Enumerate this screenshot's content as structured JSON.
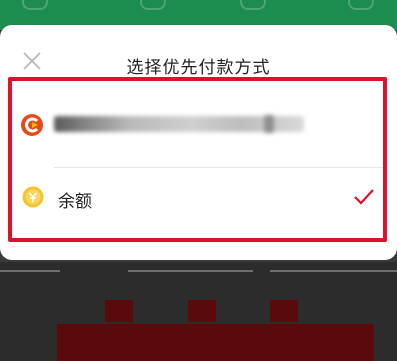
{
  "sheet": {
    "title": "选择优先付款方式"
  },
  "options": [
    {
      "id": "bank",
      "label_blurred": true,
      "icon": "bank-logo-icon",
      "selected": false
    },
    {
      "id": "balance",
      "label": "余额",
      "icon": "coin-icon",
      "selected": true
    }
  ],
  "colors": {
    "accent_red": "#e0112a",
    "bank_logo_red": "#e64a19",
    "coin_yellow": "#f4c430",
    "header_green": "#1d8c4f"
  }
}
